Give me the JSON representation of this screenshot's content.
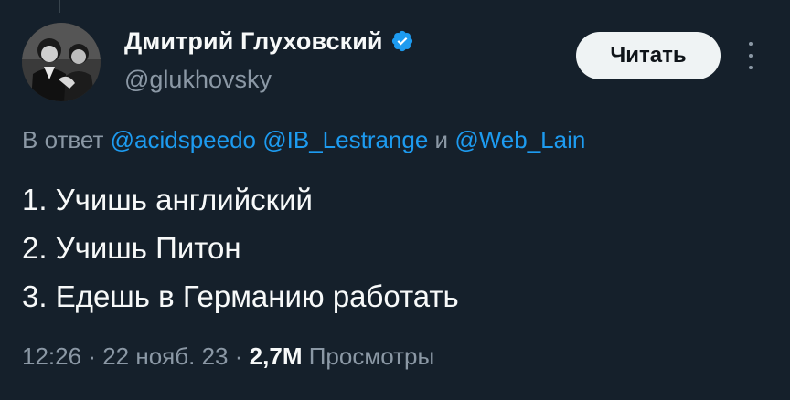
{
  "tweet": {
    "author": {
      "name": "Дмитрий Глуховский",
      "handle": "@glukhovsky",
      "verified_icon": "verified-badge-icon",
      "verified_color": "#1d9bf0"
    },
    "follow_button_label": "Читать",
    "more_icon": "more-options-icon",
    "reply_context": {
      "prefix": "В ответ",
      "mentions": [
        "@acidspeedo",
        "@IB_Lestrange",
        "@Web_Lain"
      ],
      "conjunction": "и"
    },
    "lines": [
      "1. Учишь английский",
      "2. Учишь Питон",
      "3. Едешь в Германию работать"
    ],
    "meta": {
      "time": "12:26",
      "separator": "·",
      "date": "22 нояб. 23",
      "views_count": "2,7M",
      "views_label": "Просмотры"
    }
  },
  "colors": {
    "background": "#15202b",
    "text_primary": "#f7f9f9",
    "text_secondary": "#8b98a5",
    "accent": "#1d9bf0",
    "button_bg": "#eff3f4"
  }
}
